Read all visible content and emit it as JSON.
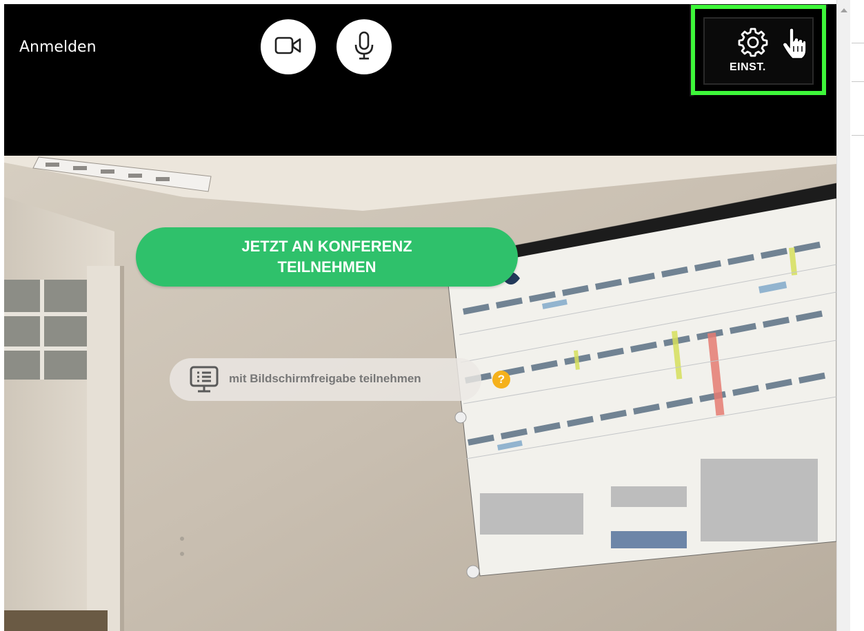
{
  "header": {
    "signin_label": "Anmelden",
    "camera_icon": "video-camera-icon",
    "microphone_icon": "microphone-icon",
    "settings": {
      "label": "EINST.",
      "icon": "gear-icon",
      "highlight_color": "#3ef73a"
    }
  },
  "main": {
    "join_button": {
      "line1": "JETZT AN KONFERENZ",
      "line2": "TEILNEHMEN",
      "color": "#2fc16b"
    },
    "screenshare_button": {
      "label": "mit Bildschirmfreigabe teilnehmen",
      "icon": "screen-share-icon"
    },
    "help": {
      "label": "?",
      "color": "#f5b11c"
    }
  }
}
